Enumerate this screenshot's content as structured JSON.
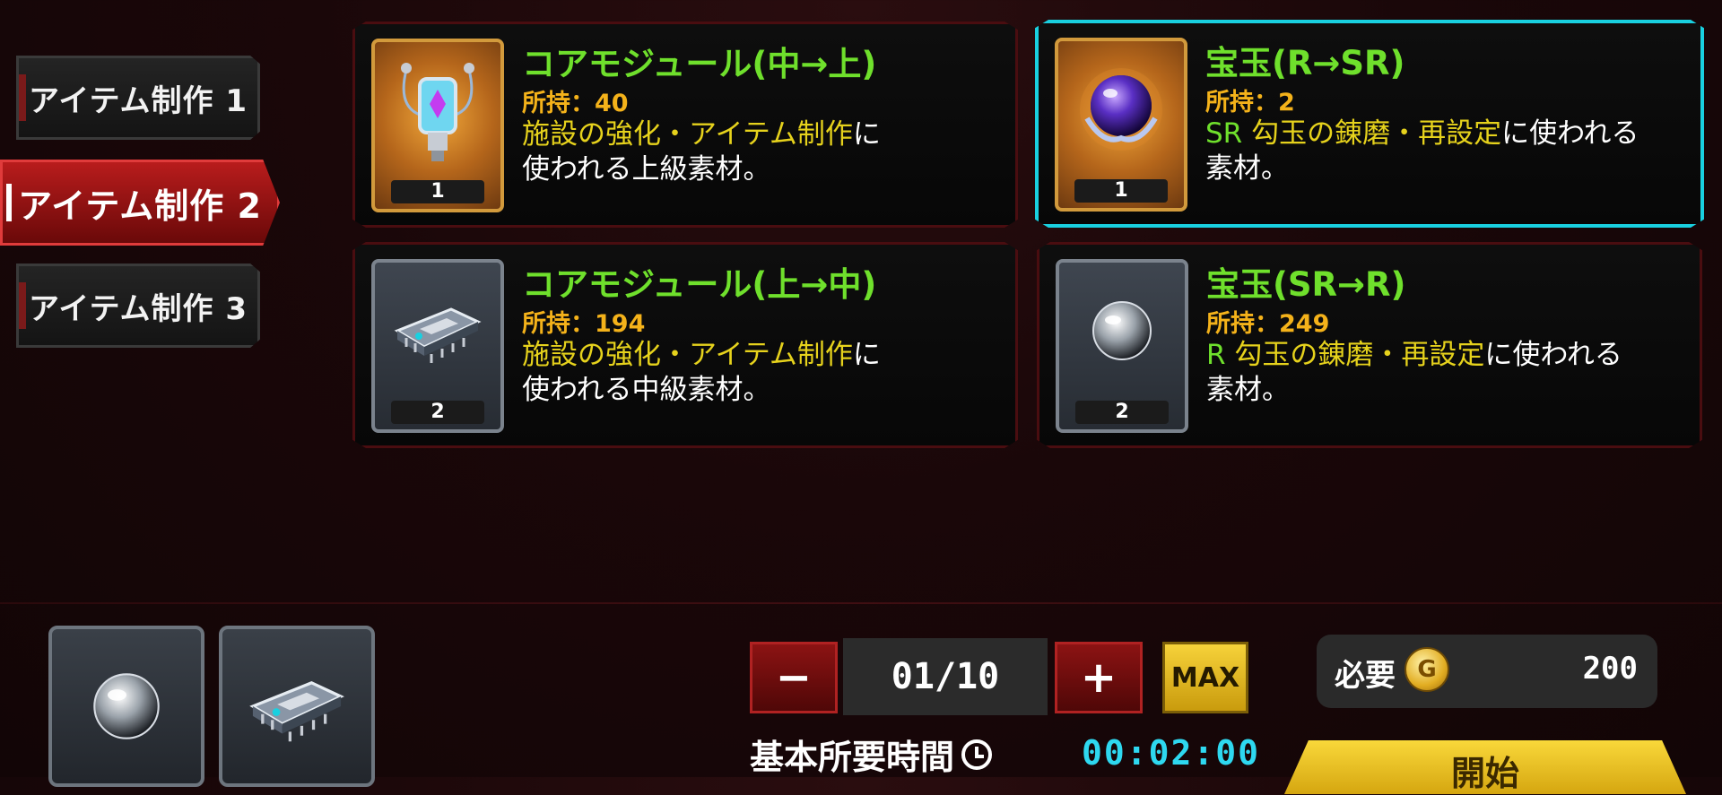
{
  "tabs": [
    {
      "label": "アイテム制作 1",
      "active": false
    },
    {
      "label": "アイテム制作 2",
      "active": true
    },
    {
      "label": "アイテム制作 3",
      "active": false
    }
  ],
  "cards": [
    {
      "title": "コアモジュール(中→上)",
      "count": "所持：40",
      "thumb_num": "1",
      "desc_hl": "施設の強化・アイテム制作",
      "desc_rest": "に",
      "desc_line2": "使われる上級素材。",
      "icon": "core-module-lantern-icon",
      "frame": "gold",
      "selected": false
    },
    {
      "title": "宝玉(R→SR)",
      "count": "所持：2",
      "thumb_num": "1",
      "desc_prefix": "SR",
      "desc_hl": "勾玉の錬磨・再設定",
      "desc_rest": "に使われる",
      "desc_line2": "素材。",
      "icon": "purple-orb-icon",
      "frame": "gold",
      "selected": true
    },
    {
      "title": "コアモジュール(上→中)",
      "count": "所持：194",
      "thumb_num": "2",
      "desc_hl": "施設の強化・アイテム制作",
      "desc_rest": "に",
      "desc_line2": "使われる中級素材。",
      "icon": "chip-icon",
      "frame": "silver",
      "selected": false
    },
    {
      "title": "宝玉(SR→R)",
      "count": "所持：249",
      "thumb_num": "2",
      "desc_prefix": "R",
      "desc_hl": "勾玉の錬磨・再設定",
      "desc_rest": "に使われる",
      "desc_line2": "素材。",
      "icon": "clear-orb-icon",
      "frame": "silver",
      "selected": false
    }
  ],
  "materials": [
    {
      "icon": "clear-orb-icon"
    },
    {
      "icon": "chip-icon"
    }
  ],
  "controls": {
    "minus": "−",
    "plus": "+",
    "quantity": "01/10",
    "max": "MAX"
  },
  "cost": {
    "label": "必要",
    "coin": "G",
    "value": "200"
  },
  "time": {
    "label": "基本所要時間",
    "value": "00:02:00"
  },
  "start": {
    "label": "開始"
  },
  "colors": {
    "title_green": "#6fe02c",
    "count_orange": "#f4b21a",
    "highlight_yellow": "#e6d21c",
    "selected_cyan": "#19d0e0",
    "tab_active_red": "#b81c1c",
    "time_cyan": "#2ed8f0",
    "start_yellow": "#f9d83a"
  }
}
